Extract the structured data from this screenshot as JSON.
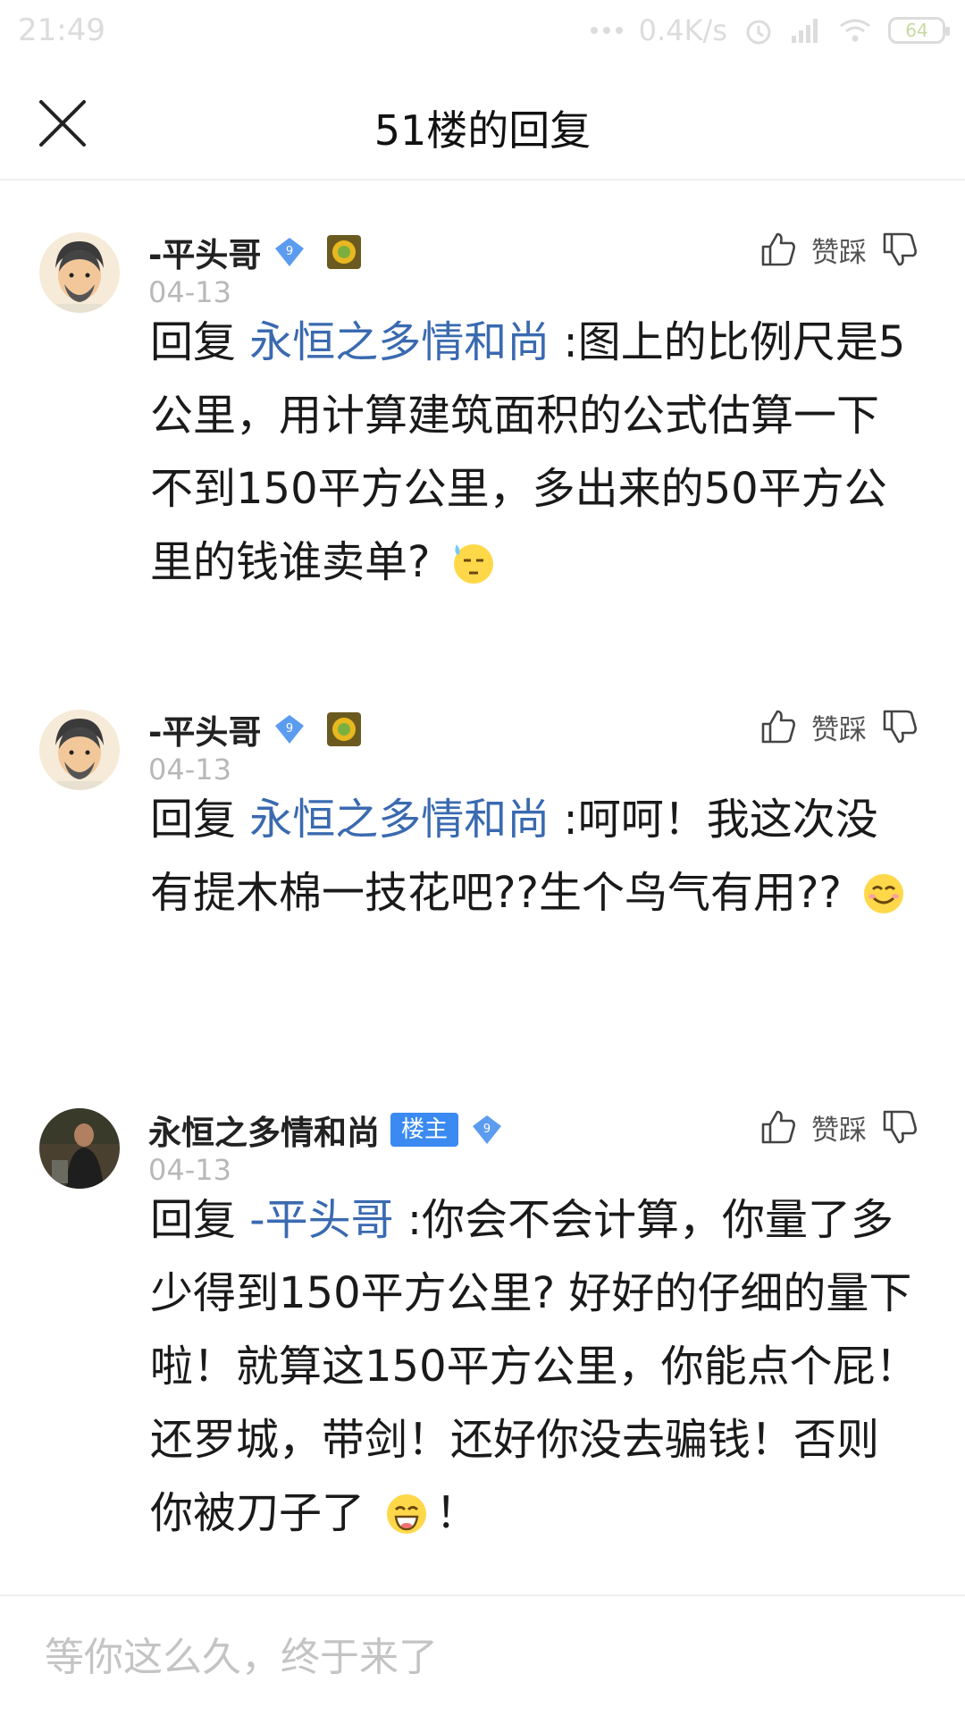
{
  "status_bar": {
    "time": "21:49",
    "net_speed": "0.4K/s",
    "battery": "64"
  },
  "header": {
    "title": "51楼的回复"
  },
  "replies": [
    {
      "username": "-平头哥",
      "level": "9",
      "owner_tag": "",
      "date": "04-13",
      "like_label": "赞",
      "dislike_label": "踩",
      "prefix": "回复 ",
      "mention": "永恒之多情和尚",
      "text": " :图上的比例尺是5公里，用计算建筑面积的公式估算一下不到150平方公里，多出来的50平方公里的钱谁卖单?",
      "tail": ""
    },
    {
      "username": "-平头哥",
      "level": "9",
      "owner_tag": "",
      "date": "04-13",
      "like_label": "赞",
      "dislike_label": "踩",
      "prefix": "回复 ",
      "mention": "永恒之多情和尚",
      "text": " :呵呵！我这次没有提木棉一技花吧??生个鸟气有用??",
      "tail": ""
    },
    {
      "username": "永恒之多情和尚",
      "level": "9",
      "owner_tag": "楼主",
      "date": "04-13",
      "like_label": "赞",
      "dislike_label": "踩",
      "prefix": "回复 ",
      "mention": "-平头哥",
      "text": " :你会不会计算，你量了多少得到150平方公里? 好好的仔细的量下啦！就算这150平方公里，你能点个屁！还罗城，带剑！还好你没去骗钱！否则你被刀子了",
      "tail": "！"
    }
  ],
  "input": {
    "placeholder": "等你这么久，终于来了"
  },
  "colors": {
    "mention": "#3a6ab0",
    "owner_tag": "#3a8af2",
    "level_badge": "#5b9cf0"
  }
}
